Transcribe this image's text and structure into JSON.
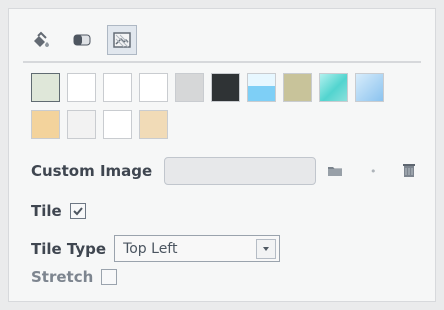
{
  "tabs": [
    {
      "name": "paint-bucket",
      "active": false
    },
    {
      "name": "contrast",
      "active": false
    },
    {
      "name": "image",
      "active": true
    }
  ],
  "swatches": {
    "row1": [
      {
        "type": "plain",
        "color": "#dfe7d9"
      },
      {
        "type": "grid",
        "color": "#1b58c7"
      },
      {
        "type": "grid",
        "color": "#ff8a1f"
      },
      {
        "type": "grid",
        "color": "#f26f55"
      },
      {
        "type": "solid",
        "color": "#d6d7d8"
      },
      {
        "type": "solid",
        "color": "#2f3335"
      },
      {
        "type": "solid",
        "color": "#7ecff6"
      },
      {
        "type": "solid",
        "color": "#c8c39a"
      },
      {
        "type": "solid",
        "color": "#52d4cf"
      },
      {
        "type": "solid",
        "color": "#8bc3ef"
      }
    ],
    "row2": [
      {
        "type": "solid",
        "color": "#f3d39c"
      },
      {
        "type": "solid",
        "color": "#f2f2f2"
      },
      {
        "type": "grid",
        "color": "#d34bcf"
      },
      {
        "type": "solid",
        "color": "#f1dbb7"
      }
    ]
  },
  "labels": {
    "custom_image": "Custom Image",
    "tile": "Tile",
    "tile_type": "Tile Type",
    "stretch": "Stretch"
  },
  "controls": {
    "custom_image_value": "",
    "tile_checked": true,
    "tile_type_selected": "Top Left",
    "stretch_checked": false
  },
  "icons": {
    "browse": "folder-icon",
    "clear": "clear-icon"
  }
}
